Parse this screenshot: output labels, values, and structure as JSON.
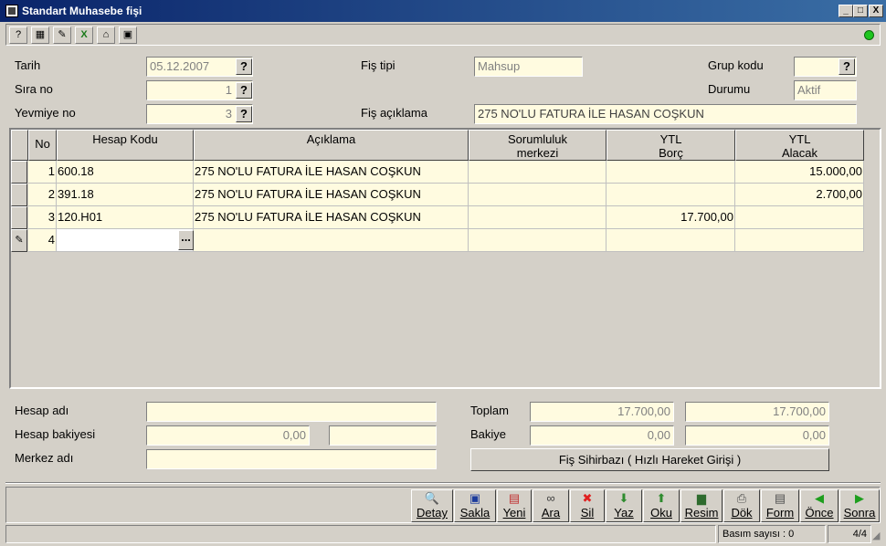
{
  "window": {
    "title": "Standart Muhasebe fişi",
    "controls": {
      "minimize": "_",
      "maximize": "□",
      "close": "X"
    }
  },
  "toolbar": {
    "icons": [
      "help-icon",
      "calculator-icon",
      "print-preview-icon",
      "excel-icon",
      "home-icon",
      "screen-icon"
    ],
    "glyphs": [
      "?",
      "▦",
      "✎",
      "X",
      "⌂",
      "▣"
    ],
    "status_color": "#1ec51e"
  },
  "header": {
    "tarih_label": "Tarih",
    "tarih_value": "05.12.2007",
    "sira_label": "Sıra no",
    "sira_value": "1",
    "yevmiye_label": "Yevmiye no",
    "yevmiye_value": "3",
    "fis_tipi_label": "Fiş tipi",
    "fis_tipi_value": "Mahsup",
    "fis_aciklama_label": "Fiş açıklama",
    "fis_aciklama_value": "275 NO'LU FATURA İLE HASAN COŞKUN",
    "grup_kodu_label": "Grup kodu",
    "grup_kodu_value": "",
    "durumu_label": "Durumu",
    "durumu_value": "Aktif",
    "help_glyph": "?"
  },
  "grid": {
    "columns": {
      "no": "No",
      "hesap_kodu": "Hesap Kodu",
      "aciklama": "Açıklama",
      "sorumluluk_1": "Sorumluluk",
      "sorumluluk_2": "merkezi",
      "borc_1": "YTL",
      "borc_2": "Borç",
      "alacak_1": "YTL",
      "alacak_2": "Alacak"
    },
    "rows": [
      {
        "no": "1",
        "hesap": "600.18",
        "aciklama": "275 NO'LU FATURA İLE HASAN COŞKUN",
        "sorumluluk": "",
        "borc": "",
        "alacak": "15.000,00"
      },
      {
        "no": "2",
        "hesap": "391.18",
        "aciklama": "275 NO'LU FATURA İLE HASAN COŞKUN",
        "sorumluluk": "",
        "borc": "",
        "alacak": "2.700,00"
      },
      {
        "no": "3",
        "hesap": "120.H01",
        "aciklama": "275 NO'LU FATURA İLE HASAN COŞKUN",
        "sorumluluk": "",
        "borc": "17.700,00",
        "alacak": ""
      },
      {
        "no": "4",
        "hesap": "",
        "aciklama": "",
        "sorumluluk": "",
        "borc": "",
        "alacak": ""
      }
    ],
    "edit_row_indicator": "✎",
    "ellipsis": "..."
  },
  "footer": {
    "hesap_adi_label": "Hesap adı",
    "hesap_adi_value": "",
    "hesap_bakiyesi_label": "Hesap bakiyesi",
    "hesap_bakiyesi_value": "0,00",
    "hesap_bakiyesi_value2": "",
    "merkez_adi_label": "Merkez adı",
    "merkez_adi_value": "",
    "toplam_label": "Toplam",
    "toplam_borc": "17.700,00",
    "toplam_alacak": "17.700,00",
    "bakiye_label": "Bakiye",
    "bakiye_borc": "0,00",
    "bakiye_alacak": "0,00",
    "wizard_button": "Fiş Sihirbazı ( Hızlı Hareket Girişi )"
  },
  "actions": [
    {
      "label": "Detay",
      "icon": "magnifier-icon",
      "glyph": "🔍",
      "color": "#3a6ea5"
    },
    {
      "label": "Sakla",
      "icon": "save-icon",
      "glyph": "▣",
      "color": "#1c3c9c"
    },
    {
      "label": "Yeni",
      "icon": "new-document-icon",
      "glyph": "▤",
      "color": "#c03030"
    },
    {
      "label": "Ara",
      "icon": "binoculars-icon",
      "glyph": "∞",
      "color": "#404040"
    },
    {
      "label": "Sil",
      "icon": "delete-icon",
      "glyph": "✖",
      "color": "#e02020"
    },
    {
      "label": "Yaz",
      "icon": "write-icon",
      "glyph": "⬇",
      "color": "#2e8b2e"
    },
    {
      "label": "Oku",
      "icon": "read-icon",
      "glyph": "⬆",
      "color": "#2e8b2e"
    },
    {
      "label": "Resim",
      "icon": "picture-icon",
      "glyph": "▆",
      "color": "#2e6b2e"
    },
    {
      "label": "Dök",
      "icon": "printer-icon",
      "glyph": "⎙",
      "color": "#505050"
    },
    {
      "label": "Form",
      "icon": "form-icon",
      "glyph": "▤",
      "color": "#505050"
    },
    {
      "label": "Önce",
      "icon": "previous-icon",
      "glyph": "◀",
      "color": "#1e9e1e"
    },
    {
      "label": "Sonra",
      "icon": "next-icon",
      "glyph": "▶",
      "color": "#1e9e1e"
    }
  ],
  "statusbar": {
    "print_count": "Basım sayısı : 0",
    "page": "4/4"
  }
}
